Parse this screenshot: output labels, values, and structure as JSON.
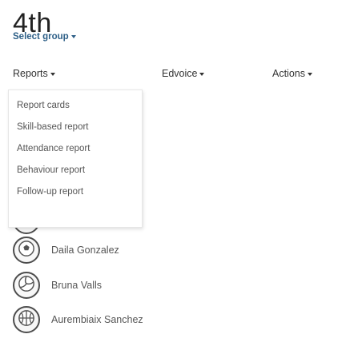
{
  "header": {
    "title": "4th",
    "group_select_label": "Select group"
  },
  "nav": {
    "reports": "Reports",
    "edvoice": "Edvoice",
    "actions": "Actions"
  },
  "reports_menu": {
    "items": [
      "Report cards",
      "Skill-based report",
      "Attendance report",
      "Behaviour report",
      "Follow-up report"
    ]
  },
  "students": [
    {
      "name": "Daila Gonzalez",
      "icon": "football-icon"
    },
    {
      "name": "Bruna Valls",
      "icon": "volleyball-icon"
    },
    {
      "name": "Aurembiaix Sanchez",
      "icon": "basketball-icon"
    }
  ],
  "colors": {
    "group_link": "#2d5f87",
    "text": "#333333",
    "avatar_border": "#4d4d4d"
  }
}
